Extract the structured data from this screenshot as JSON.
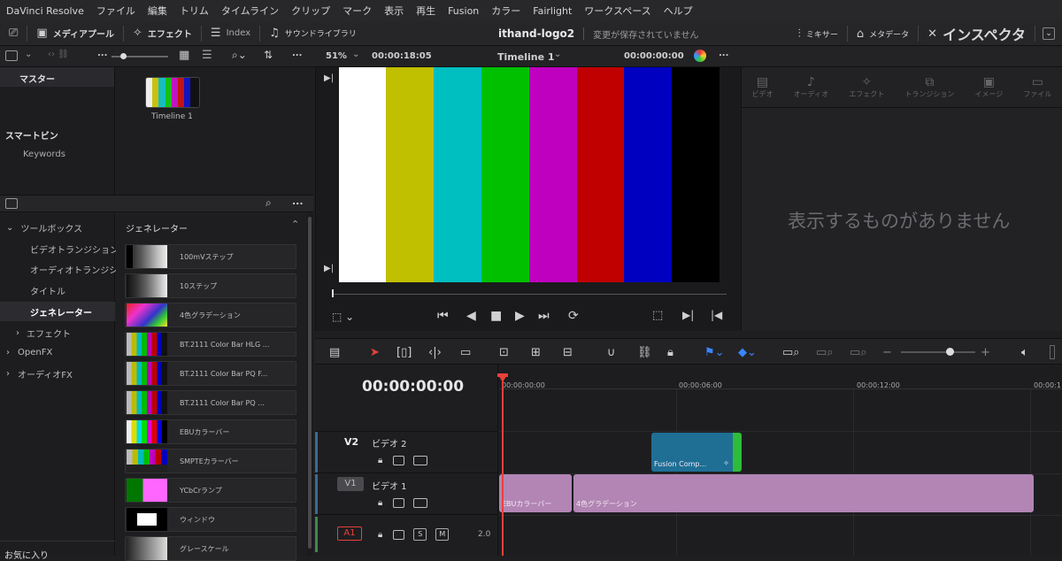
{
  "menu": [
    "DaVinci Resolve",
    "ファイル",
    "編集",
    "トリム",
    "タイムライン",
    "クリップ",
    "マーク",
    "表示",
    "再生",
    "Fusion",
    "カラー",
    "Fairlight",
    "ワークスペース",
    "ヘルプ"
  ],
  "toolbar": {
    "media_pool": "メディアプール",
    "effects": "エフェクト",
    "index": "Index",
    "sound_library": "サウンドライブラリ",
    "project_title": "ithand-logo2",
    "save_status": "変更が保存されていません",
    "mixer": "ミキサー",
    "metadata": "メタデータ",
    "inspector": "インスペクタ"
  },
  "subbar": {
    "dots": "...",
    "zoom": "51%",
    "timecode": "00:00:18:05",
    "timeline_name": "Timeline 1",
    "timecode_right": "00:00:00:00",
    "more": "..."
  },
  "bins": {
    "master": "マスター",
    "smart_bins": "スマートビン",
    "keywords": "Keywords"
  },
  "media": {
    "clip_name": "Timeline 1"
  },
  "inspector": {
    "tabs": [
      "ビデオ",
      "オーディオ",
      "エフェクト",
      "トランジション",
      "イメージ",
      "ファイル"
    ],
    "empty": "表示するものがありません"
  },
  "effects_tree": {
    "toolbox": "ツールボックス",
    "video_transition": "ビデオトランジション",
    "audio_transition": "オーディオトランジシ...",
    "title": "タイトル",
    "generator": "ジェネレーター",
    "effect": "エフェクト",
    "openfx": "OpenFX",
    "audiofx": "オーディオFX",
    "favorites": "お気に入り"
  },
  "generators": {
    "header": "ジェネレーター",
    "items": [
      "100mVステップ",
      "10ステップ",
      "4色グラデーション",
      "BT.2111 Color Bar HLG ...",
      "BT.2111 Color Bar PQ F...",
      "BT.2111 Color Bar PQ ...",
      "EBUカラーバー",
      "SMPTEカラーバー",
      "YCbCrランプ",
      "ウィンドウ",
      "グレースケール"
    ]
  },
  "timeline": {
    "timecode": "00:00:00:00",
    "ruler": [
      "00:00:00:00",
      "00:00:06:00",
      "00:00:12:00",
      "00:00:1"
    ],
    "v2_label": "V2",
    "v2_name": "ビデオ 2",
    "v1_label": "V1",
    "v1_name": "ビデオ 1",
    "a1_label": "A1",
    "a1_level": "2.0",
    "s_btn": "S",
    "m_btn": "M",
    "clip_fusion": "Fusion Comp...",
    "clip_ebu": "EBUカラーバー",
    "clip_grad": "4色グラデーション"
  },
  "colors": {
    "accent_red": "#e8413a",
    "clip_purple": "#b285b4",
    "clip_blue": "#1f6f95"
  }
}
